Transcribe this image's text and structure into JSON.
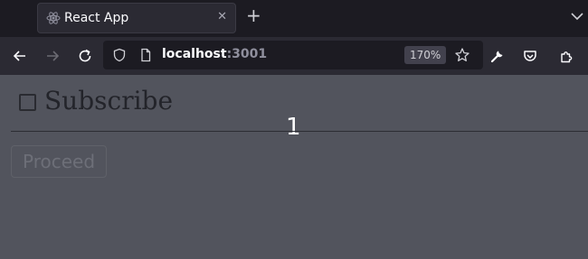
{
  "browser": {
    "tab_title": "React App",
    "url_host": "localhost",
    "url_port": ":3001",
    "zoom": "170%",
    "icons": [
      "react-icon",
      "close-icon",
      "plus-icon",
      "chevron-down-icon",
      "back-arrow-icon",
      "forward-arrow-icon",
      "reload-icon",
      "shield-icon",
      "page-icon",
      "star-icon",
      "wrench-icon",
      "pocket-icon",
      "extensions-icon"
    ]
  },
  "page": {
    "checkbox_label": "Subscribe",
    "checkbox_checked": false,
    "count": "1",
    "proceed_label": "Proceed",
    "proceed_disabled": true
  },
  "colors": {
    "page_bg": "#52545d",
    "chrome_dark": "#1c1b22",
    "chrome": "#2b2a33"
  }
}
